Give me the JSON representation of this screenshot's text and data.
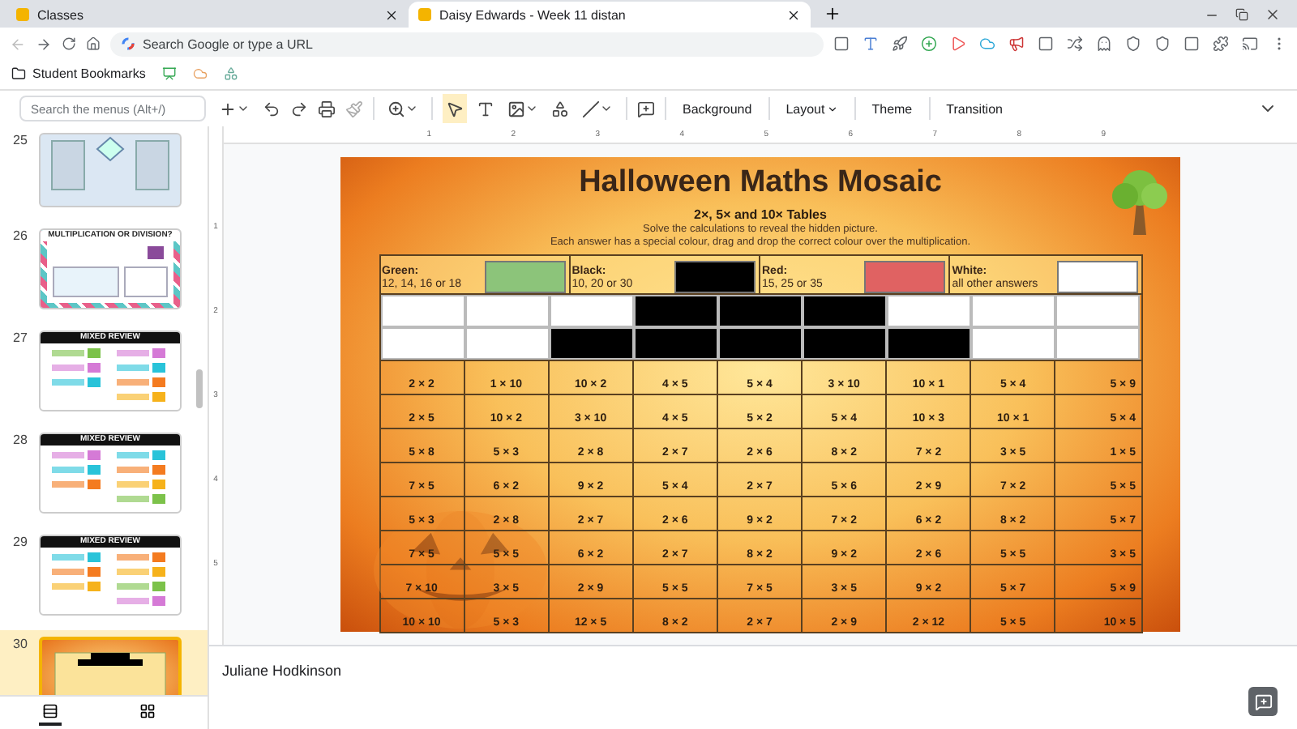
{
  "browser": {
    "tabs": [
      {
        "title": "Classes",
        "selected": false
      },
      {
        "title": "Daisy Edwards - Week 11 distan",
        "selected": true
      }
    ],
    "address": {
      "placeholder": "Search Google or type a URL"
    },
    "bookmarks": [
      {
        "label": "Student Bookmarks"
      }
    ]
  },
  "toolbar": {
    "search": {
      "placeholder": "Search the menus (Alt+/)"
    },
    "buttons": [
      {
        "label": "Background",
        "dropdown": false
      },
      {
        "label": "Layout",
        "dropdown": true
      },
      {
        "label": "Theme",
        "dropdown": false
      },
      {
        "label": "Transition",
        "dropdown": false
      }
    ]
  },
  "rulers": {
    "horizontal": [
      "1",
      "2",
      "3",
      "4",
      "5",
      "6",
      "7",
      "8",
      "9"
    ],
    "vertical": [
      "1",
      "2",
      "3",
      "4",
      "5"
    ]
  },
  "slides": [
    {
      "number": "25",
      "kind": "diagram",
      "selected": false
    },
    {
      "number": "26",
      "kind": "quiz",
      "title": "MULTIPLICATION OR DIVISION?",
      "selected": false
    },
    {
      "number": "27",
      "kind": "review",
      "title": "MIXED REVIEW",
      "selected": false
    },
    {
      "number": "28",
      "kind": "review",
      "title": "MIXED REVIEW",
      "selected": false
    },
    {
      "number": "29",
      "kind": "review",
      "title": "MIXED REVIEW",
      "selected": false
    },
    {
      "number": "30",
      "kind": "mosaic",
      "selected": true
    }
  ],
  "slide": {
    "title": "Halloween Maths Mosaic",
    "subtitle": "2×, 5× and 10× Tables",
    "instructions": [
      "Solve the calculations to reveal the hidden picture.",
      "Each answer has a special colour, drag and drop the correct colour over the multiplication."
    ],
    "legend": [
      {
        "name": "Green:",
        "values": "12, 14, 16 or 18",
        "color": "#8cc47a"
      },
      {
        "name": "Black:",
        "values": "10, 20 or 30",
        "color": "#000000"
      },
      {
        "name": "Red:",
        "values": "15, 25 or 35",
        "color": "#e06262"
      },
      {
        "name": "White:",
        "values": "all other answers",
        "color": "#ffffff"
      }
    ],
    "tile_rows": [
      [
        {
          "color": "#ffffff"
        },
        {
          "color": "#ffffff"
        },
        {
          "color": "#ffffff"
        },
        {
          "color": "#000000"
        },
        {
          "color": "#000000"
        },
        {
          "color": "#000000"
        },
        {
          "color": "#ffffff"
        },
        {
          "color": "#ffffff"
        },
        {
          "color": "#ffffff"
        }
      ],
      [
        {
          "color": "#ffffff"
        },
        {
          "color": "#ffffff"
        },
        {
          "color": "#000000"
        },
        {
          "color": "#000000"
        },
        {
          "color": "#000000"
        },
        {
          "color": "#000000"
        },
        {
          "color": "#000000"
        },
        {
          "color": "#ffffff"
        },
        {
          "color": "#ffffff"
        }
      ]
    ],
    "rows": [
      [
        "2 × 2",
        "1 × 10",
        "10 × 2",
        "4 × 5",
        "5 × 4",
        "3 × 10",
        "10 × 1",
        "5 × 4",
        "5 × 9"
      ],
      [
        "2 × 5",
        "10 × 2",
        "3 × 10",
        "4 × 5",
        "5 × 2",
        "5 × 4",
        "10 × 3",
        "10 × 1",
        "5 × 4"
      ],
      [
        "5 × 8",
        "5 × 3",
        "2 × 8",
        "2 × 7",
        "2 × 6",
        "8 × 2",
        "7 × 2",
        "3 × 5",
        "1 × 5"
      ],
      [
        "7 × 5",
        "6 × 2",
        "9 × 2",
        "5 × 4",
        "2 × 7",
        "5 × 6",
        "2 × 9",
        "7 × 2",
        "5 × 5"
      ],
      [
        "5 × 3",
        "2 × 8",
        "2 × 7",
        "2 × 6",
        "9 × 2",
        "7 × 2",
        "6 × 2",
        "8 × 2",
        "5 × 7"
      ],
      [
        "7 × 5",
        "5 × 5",
        "6 × 2",
        "2 × 7",
        "8 × 2",
        "9 × 2",
        "2 × 6",
        "5 × 5",
        "3 × 5"
      ],
      [
        "7 × 10",
        "3 × 5",
        "2 × 9",
        "5 × 5",
        "7 × 5",
        "3 × 5",
        "9 × 2",
        "5 × 7",
        "5 × 9"
      ],
      [
        "10 × 10",
        "5 × 3",
        "12 × 5",
        "8 × 2",
        "2 × 7",
        "2 × 9",
        "2 × 12",
        "5 × 5",
        "10 × 5"
      ]
    ]
  },
  "notes": {
    "text": "Juliane Hodkinson"
  }
}
